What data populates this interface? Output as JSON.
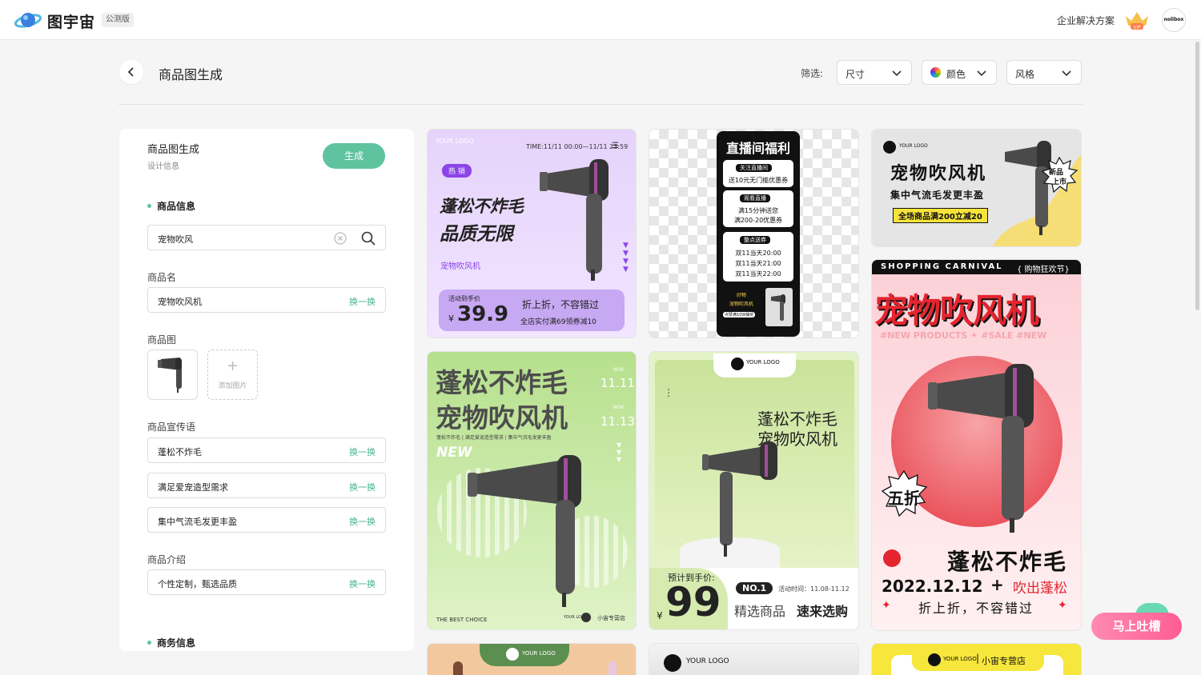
{
  "brand": {
    "name": "图宇宙",
    "badge": "公测版"
  },
  "topbar": {
    "enterprise": "企业解决方案",
    "avatar_text": "nolibox"
  },
  "page": {
    "title": "商品图生成"
  },
  "filters": {
    "label": "筛选:",
    "size": "尺寸",
    "color": "颜色",
    "style": "风格"
  },
  "panel": {
    "title": "商品图生成",
    "subtitle": "设计信息",
    "generate": "生成",
    "product_info": "商品信息",
    "search_value": "宠物吹风",
    "name_label": "商品名",
    "name_value": "宠物吹风机",
    "swap": "换一换",
    "image_label": "商品图",
    "add_image": "添加图片",
    "slogan_label": "商品宣传语",
    "slogans": [
      "蓬松不炸毛",
      "满足爱宠造型需求",
      "集中气流毛发更丰盈"
    ],
    "intro_label": "商品介绍",
    "intro_value": "个性定制，甄选品质",
    "business_info": "商务信息"
  },
  "cards": {
    "c1": {
      "logo": "YOUR LOGO",
      "time": "TIME:11/11 00:00—11/11 23:59",
      "tag": "热 销",
      "line1": "蓬松不炸毛",
      "line2": "品质无限",
      "sub": "宠物吹风机",
      "price_label": "活动到手价",
      "currency": "¥",
      "price": "39.9",
      "promo1": "折上折，不容错过",
      "promo2": "全店实付满69领券减10"
    },
    "c2": {
      "title": "直播间福利",
      "b1": "关注直播间",
      "t1": "送10元无门槛优惠券",
      "b2": "观看直播",
      "t2a": "满15分钟送您",
      "t2b": "满200-20优惠券",
      "b3": "整点送券",
      "t3a": "双11当天20:00",
      "t3b": "双11当天21:00",
      "t3c": "双11当天22:00",
      "gift1": "好物",
      "gift2": "宠物吹风机",
      "gift3": "点赞满10W抽奖"
    },
    "c3": {
      "logo": "YOUR LOGO",
      "title": "宠物吹风机",
      "sub": "集中气流毛发更丰盈",
      "promo": "全场商品满200立减20",
      "badge1": "新品",
      "badge2": "上市"
    },
    "c4": {
      "top_left": "SHOPPING CARNIVAL",
      "top_right": "{ 购物狂欢节}",
      "title": "宠物吹风机",
      "tags": "#NEW PRODUCTS  ✦  #SALE    #NEW",
      "badge": "五折",
      "slogan": "蓬松不炸毛",
      "date": "2022.12.12",
      "plus": "+",
      "fluffy": "吹出蓬松",
      "bottom": "折上折，不容错过"
    },
    "c5": {
      "line1": "蓬松不炸毛",
      "line2": "宠物吹风机",
      "nov1": "NOV",
      "d1": "11.11",
      "nov2": "NOV",
      "d2": "11.13",
      "small": "蓬松不炸毛 | 满足爱宠造型需求 | 集中气流毛发更丰盈",
      "new": "NEW",
      "footer_left": "THE BEST CHOICE",
      "footer_right": "小宙专营店",
      "logo": "YOUR LOGO"
    },
    "c6": {
      "logo": "YOUR LOGO",
      "line1": "蓬松不炸毛",
      "line2": "宠物吹风机",
      "price_label": "预计到手价:",
      "currency": "¥",
      "price": "99",
      "no1": "NO.1",
      "time": "活动时间：11.08-11.12",
      "slogan_a": "精选商品",
      "slogan_b": "速来选购"
    },
    "c7": {
      "logo": "YOUR LOGO"
    },
    "c8": {
      "logo": "YOUR LOGO"
    },
    "c9": {
      "logo": "YOUR LOGO",
      "shop": "小宙专营店"
    }
  },
  "feedback": "马上吐槽"
}
